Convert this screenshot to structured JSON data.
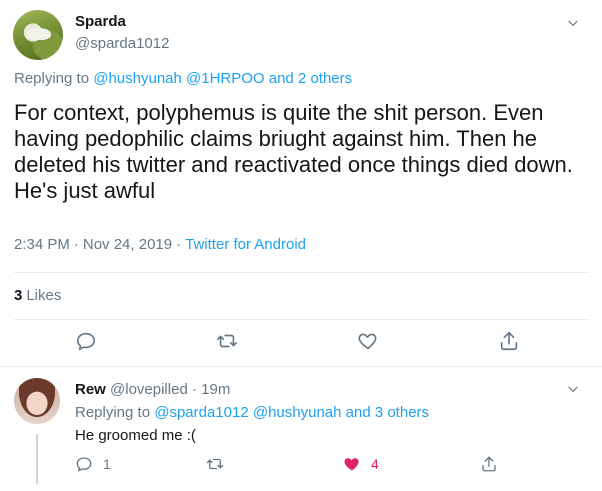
{
  "main_tweet": {
    "display_name": "Sparda",
    "handle": "@sparda1012",
    "replying_prefix": "Replying to",
    "replying_to": "@hushyunah @1HRPOO and 2 others",
    "text": "For context, polyphemus is quite the shit person. Even having pedophilic claims briught against him. Then he deleted his twitter and reactivated once things died down. He's just awful",
    "time": "2:34 PM",
    "date": "Nov 24, 2019",
    "source": "Twitter for Android",
    "likes_count": "3",
    "likes_label": "Likes",
    "icons": [
      "chevron-down-icon",
      "reply-icon",
      "retweet-icon",
      "like-icon",
      "share-icon"
    ]
  },
  "reply_tweet": {
    "display_name": "Rew",
    "handle": "@lovepilled",
    "age": "19m",
    "replying_prefix": "Replying to",
    "replying_to": "@sparda1012 @hushyunah and 3 others",
    "text": "He groomed me :(",
    "reply_count": "1",
    "like_count": "4",
    "liked": true,
    "like_color": "#e0245e",
    "icons": [
      "chevron-down-icon",
      "reply-icon",
      "retweet-icon",
      "like-filled-icon",
      "share-icon"
    ]
  },
  "colors": {
    "link": "#1da1f2",
    "secondary_text": "#657786",
    "primary_text": "#14171a",
    "divider": "#e6ecf0"
  }
}
